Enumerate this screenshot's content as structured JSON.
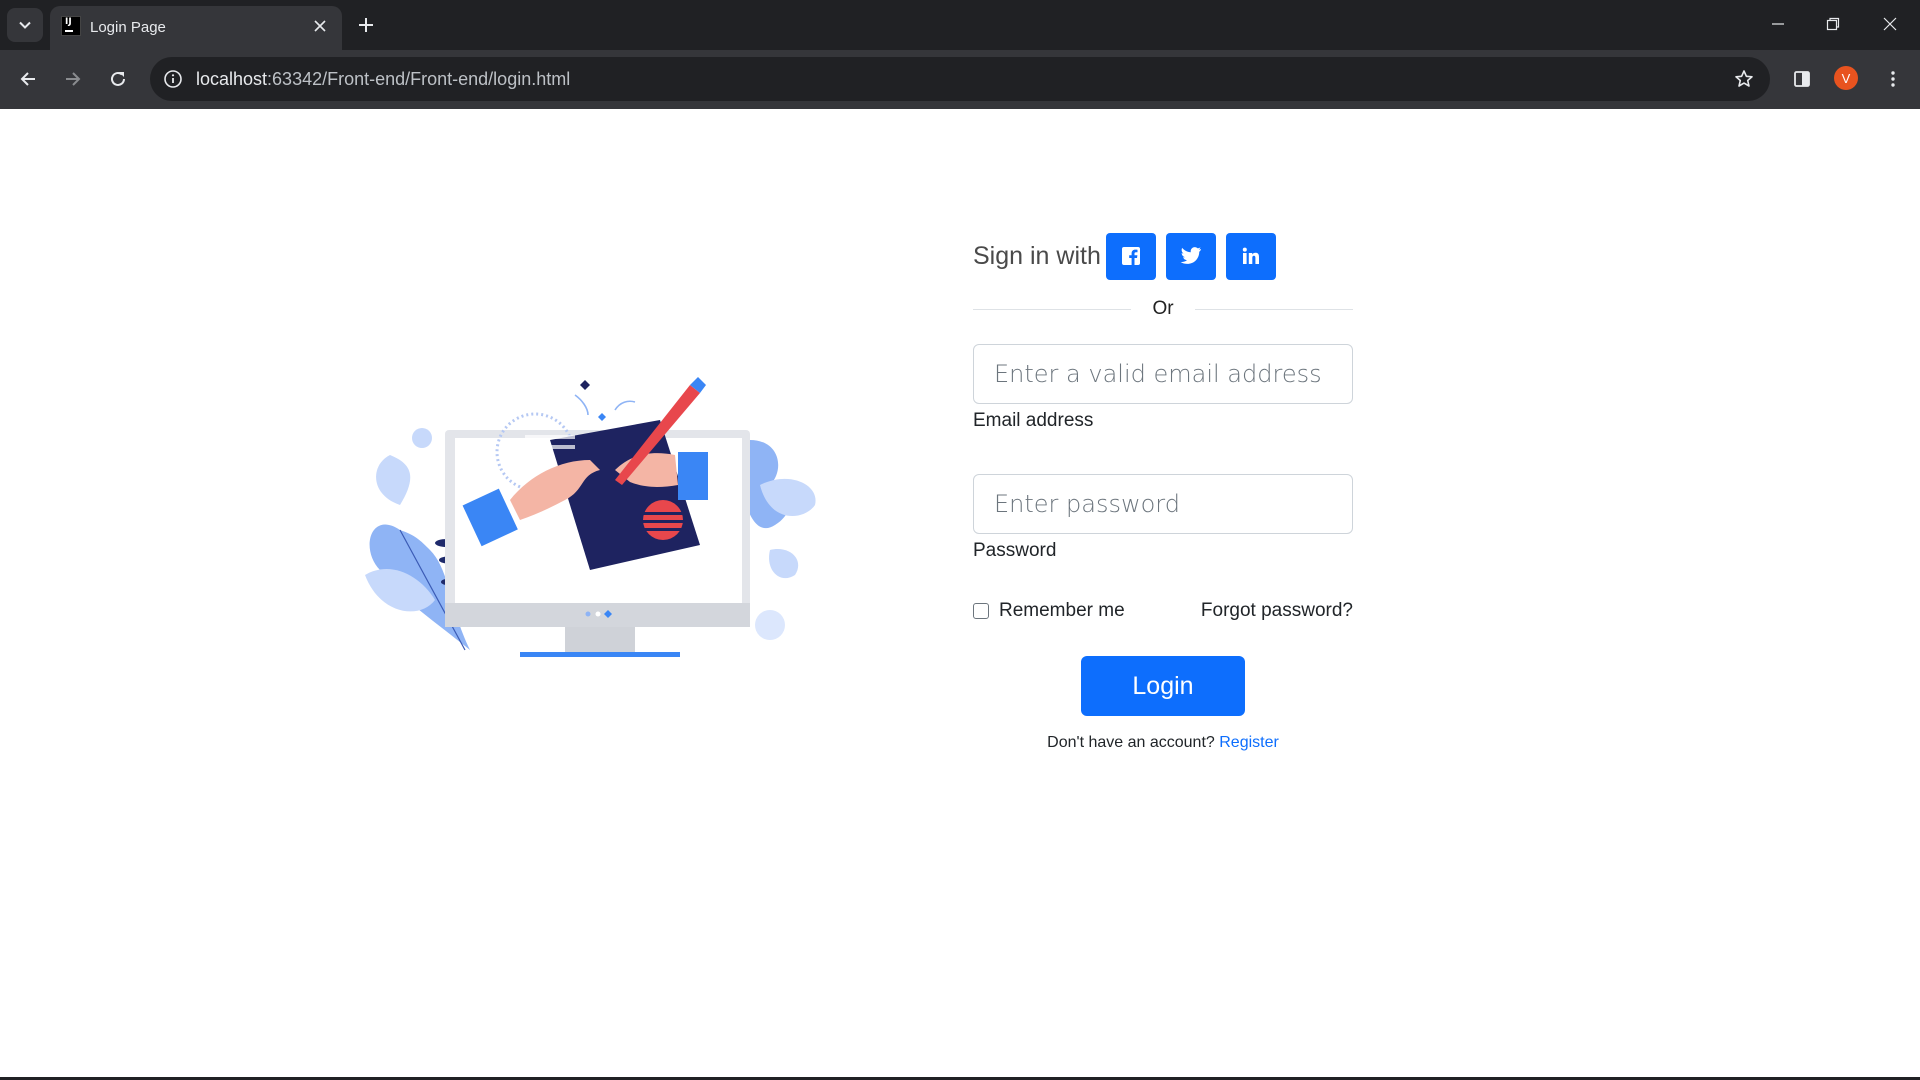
{
  "browser": {
    "tab_title": "Login Page",
    "url_host": "localhost",
    "url_path": ":63342/Front-end/Front-end/login.html",
    "profile_initial": "V"
  },
  "login": {
    "sign_in_with": "Sign in with",
    "social": [
      "facebook",
      "twitter",
      "linkedin"
    ],
    "or_text": "Or",
    "email_placeholder": "Enter a valid email address",
    "email_label": "Email address",
    "password_placeholder": "Enter password",
    "password_label": "Password",
    "remember_me": "Remember me",
    "forgot_password": "Forgot password?",
    "login_button": "Login",
    "no_account": "Don't have an account?",
    "register_link": "Register"
  },
  "colors": {
    "primary": "#0d6efd",
    "chrome_dark": "#202124",
    "chrome_toolbar": "#35363a"
  }
}
